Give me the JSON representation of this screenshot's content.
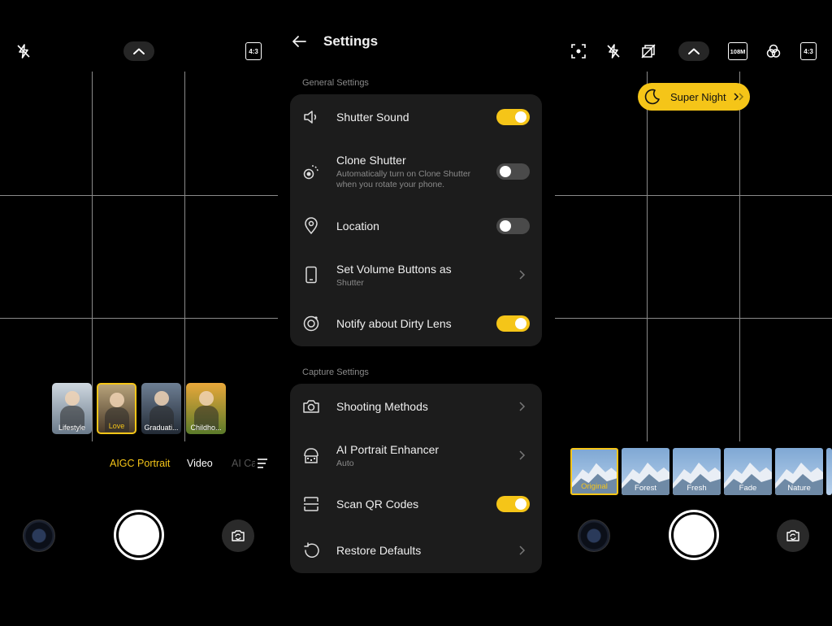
{
  "left": {
    "top_right_badge": "4:3",
    "portrait_styles": [
      {
        "label": "Lifestyle",
        "selected": false,
        "colors": [
          "#cfd8e0",
          "#6a7a8a"
        ]
      },
      {
        "label": "Love",
        "selected": true,
        "colors": [
          "#b7a27a",
          "#4a3b2a"
        ]
      },
      {
        "label": "Graduati...",
        "selected": false,
        "colors": [
          "#6e7f94",
          "#222a35"
        ]
      },
      {
        "label": "Childho...",
        "selected": false,
        "colors": [
          "#e9a83a",
          "#5a7a2a"
        ]
      }
    ],
    "modes": [
      {
        "label": "AIGC Portrait",
        "active": true
      },
      {
        "label": "Video",
        "active": false
      },
      {
        "label": "AI Ca",
        "active": false
      }
    ]
  },
  "settings": {
    "title": "Settings",
    "general_section": "General Settings",
    "general_rows": [
      {
        "icon": "speaker-icon",
        "title": "Shutter Sound",
        "subtitle": "",
        "control": "toggle",
        "on": true
      },
      {
        "icon": "clone-shutter-icon",
        "title": "Clone Shutter",
        "subtitle": "Automatically turn on Clone Shutter when you rotate your phone.",
        "control": "toggle",
        "on": false
      },
      {
        "icon": "location-pin-icon",
        "title": "Location",
        "subtitle": "",
        "control": "toggle",
        "on": false
      },
      {
        "icon": "phone-icon",
        "title": "Set Volume Buttons as",
        "subtitle": "Shutter",
        "control": "chevron"
      },
      {
        "icon": "lens-icon",
        "title": "Notify about Dirty Lens",
        "subtitle": "",
        "control": "toggle",
        "on": true
      }
    ],
    "capture_section": "Capture Settings",
    "capture_rows": [
      {
        "icon": "camera-icon",
        "title": "Shooting Methods",
        "subtitle": "",
        "control": "chevron"
      },
      {
        "icon": "portrait-enhancer-icon",
        "title": "AI Portrait Enhancer",
        "subtitle": "Auto",
        "control": "chevron"
      },
      {
        "icon": "scan-qr-icon",
        "title": "Scan QR Codes",
        "subtitle": "",
        "control": "toggle",
        "on": true
      },
      {
        "icon": "restore-icon",
        "title": "Restore Defaults",
        "subtitle": "",
        "control": "chevron"
      }
    ]
  },
  "right": {
    "resolution_badge": "108M",
    "ratio_badge": "4:3",
    "night_pill": "Super Night",
    "filters": [
      {
        "label": "Original",
        "selected": true
      },
      {
        "label": "Forest",
        "selected": false
      },
      {
        "label": "Fresh",
        "selected": false
      },
      {
        "label": "Fade",
        "selected": false
      },
      {
        "label": "Nature",
        "selected": false
      }
    ]
  },
  "colors": {
    "accent": "#f5c518",
    "card_bg": "#1c1c1c",
    "toggle_off": "#4a4a4a"
  }
}
